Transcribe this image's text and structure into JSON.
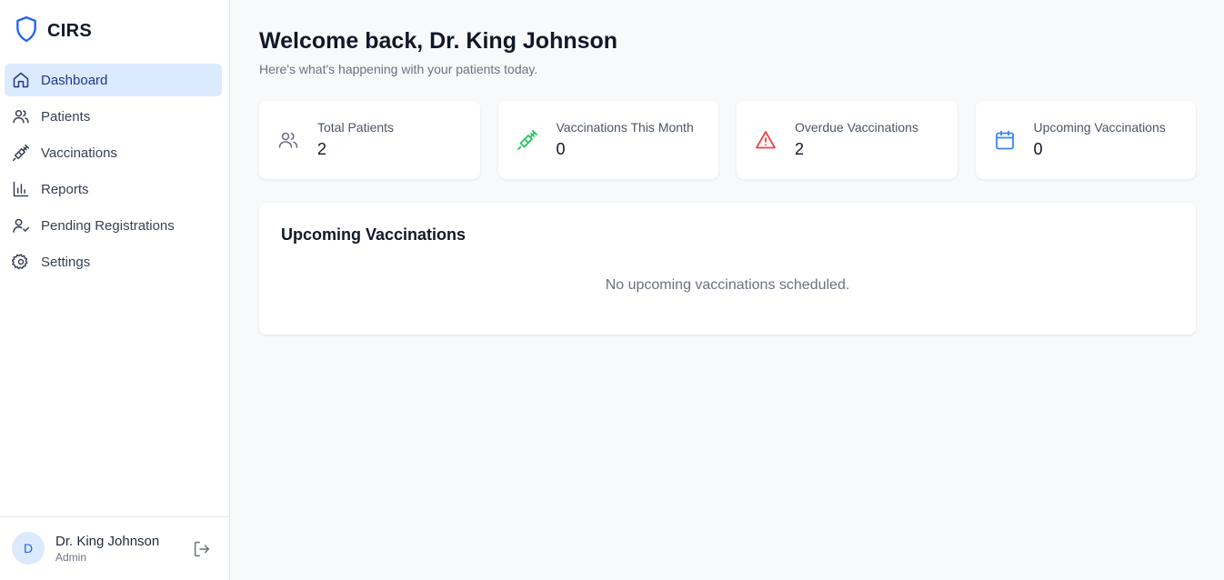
{
  "app": {
    "name": "CIRS",
    "brand_color": "#2563eb"
  },
  "sidebar": {
    "items": [
      {
        "label": "Dashboard",
        "icon": "home-icon",
        "active": true
      },
      {
        "label": "Patients",
        "icon": "users-icon"
      },
      {
        "label": "Vaccinations",
        "icon": "syringe-icon"
      },
      {
        "label": "Reports",
        "icon": "bar-chart-icon"
      },
      {
        "label": "Pending Registrations",
        "icon": "user-check-icon"
      },
      {
        "label": "Settings",
        "icon": "gear-icon"
      }
    ]
  },
  "user": {
    "initial": "D",
    "name": "Dr. King Johnson",
    "role": "Admin"
  },
  "header": {
    "title": "Welcome back, Dr. King Johnson",
    "subtitle": "Here's what's happening with your patients today."
  },
  "stats": [
    {
      "label": "Total Patients",
      "value": "2",
      "icon": "users-icon",
      "color": "#6b7280"
    },
    {
      "label": "Vaccinations This Month",
      "value": "0",
      "icon": "syringe-icon",
      "color": "#22c55e"
    },
    {
      "label": "Overdue Vaccinations",
      "value": "2",
      "icon": "alert-triangle-icon",
      "color": "#ef4444"
    },
    {
      "label": "Upcoming Vaccinations",
      "value": "0",
      "icon": "calendar-icon",
      "color": "#3b82f6"
    }
  ],
  "upcoming": {
    "title": "Upcoming Vaccinations",
    "empty_message": "No upcoming vaccinations scheduled."
  }
}
